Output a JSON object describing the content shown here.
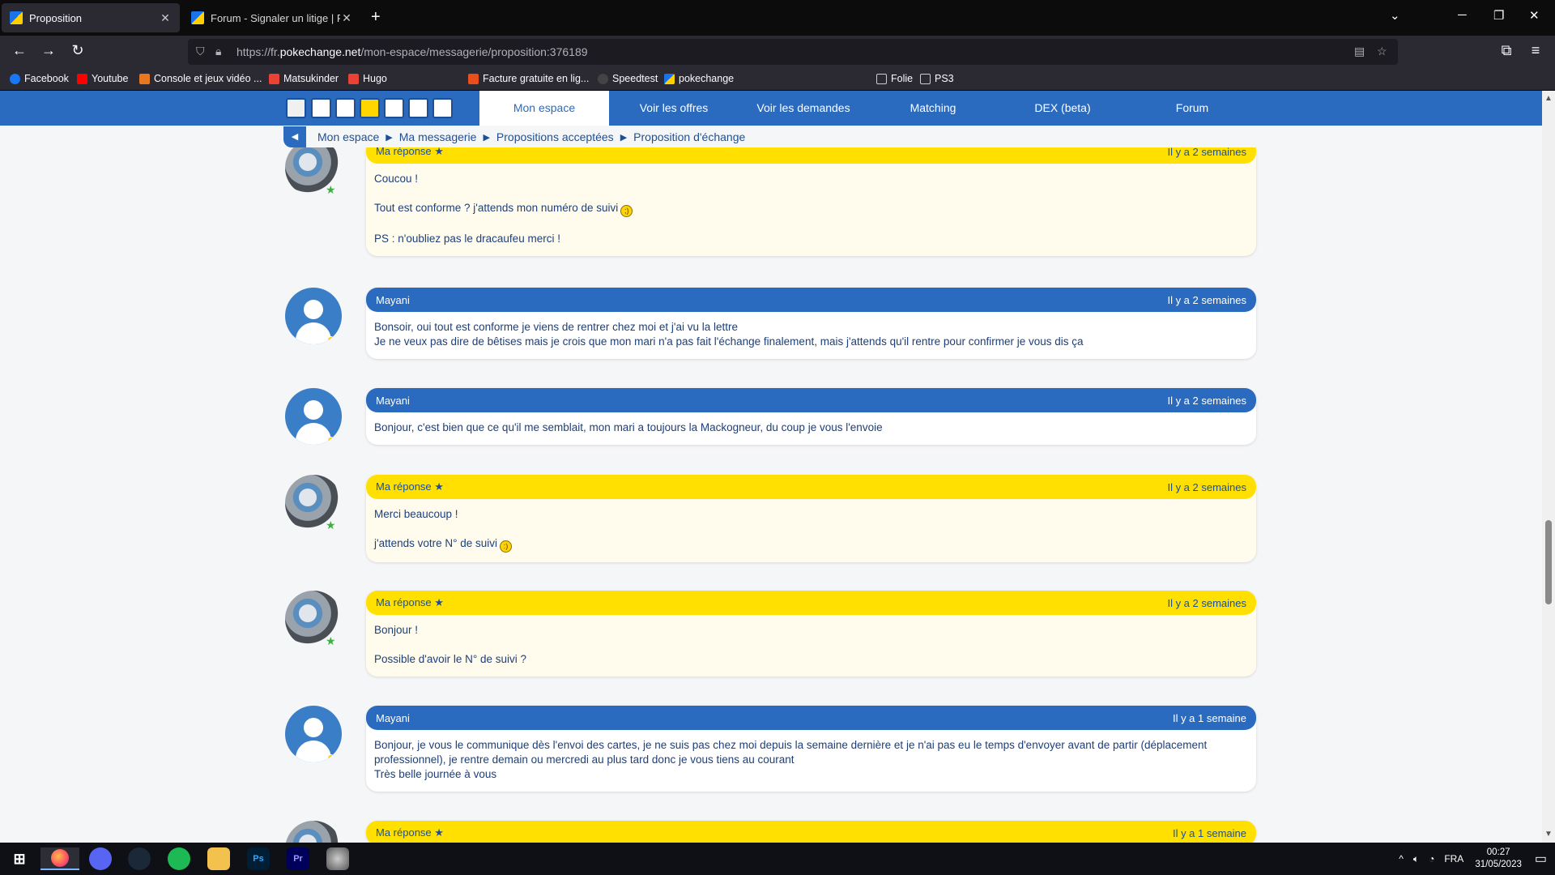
{
  "browser": {
    "tabs": [
      {
        "title": "Proposition",
        "active": true
      },
      {
        "title": "Forum - Signaler un litige | Pok",
        "active": false
      }
    ],
    "url_prefix": "https://fr.",
    "url_domain": "pokechange.net",
    "url_path": "/mon-espace/messagerie/proposition:376189",
    "bookmarks": [
      {
        "label": "Facebook",
        "color": "#1877f2"
      },
      {
        "label": "Youtube",
        "color": "#ff0000"
      },
      {
        "label": "Console et jeux vidéo ...",
        "color": "#e87722"
      },
      {
        "label": "Matsukinder",
        "color": "#ea4335"
      },
      {
        "label": "Hugo",
        "color": "#ea4335"
      },
      {
        "label": "Facture gratuite en lig...",
        "color": "#e94e1b"
      },
      {
        "label": "Speedtest",
        "color": "#444444"
      },
      {
        "label": "pokechange",
        "color": "#ffd000"
      },
      {
        "label": "Folie",
        "color": "#cccccc"
      },
      {
        "label": "PS3",
        "color": "#cccccc"
      }
    ]
  },
  "site": {
    "nav_tabs": [
      "Mon espace",
      "Voir les offres",
      "Voir les demandes",
      "Matching",
      "DEX (beta)",
      "Forum"
    ],
    "breadcrumb": [
      "Mon espace",
      "Ma messagerie",
      "Propositions acceptées",
      "Proposition d'échange"
    ]
  },
  "messages": [
    {
      "author": "Ma réponse ★",
      "time": "Il y a 2 semaines",
      "mine": true,
      "lines": [
        "Coucou !",
        "Tout est conforme ? j'attends mon numéro de suivi",
        "PS : n'oubliez pas le dracaufeu merci !"
      ]
    },
    {
      "author": "Mayani",
      "time": "Il y a 2 semaines",
      "mine": false,
      "lines": [
        "Bonsoir, oui tout est conforme je viens de rentrer chez moi et j'ai vu la lettre",
        "Je ne veux pas dire de bêtises mais je crois que mon mari n'a pas fait l'échange finalement, mais j'attends qu'il rentre pour confirmer je vous dis ça"
      ]
    },
    {
      "author": "Mayani",
      "time": "Il y a 2 semaines",
      "mine": false,
      "lines": [
        "Bonjour, c'est bien que ce qu'il me semblait, mon mari a toujours la Mackogneur, du coup je vous l'envoie"
      ]
    },
    {
      "author": "Ma réponse ★",
      "time": "Il y a 2 semaines",
      "mine": true,
      "lines": [
        "Merci beaucoup !",
        "j'attends votre N° de suivi"
      ]
    },
    {
      "author": "Ma réponse ★",
      "time": "Il y a 2 semaines",
      "mine": true,
      "lines": [
        "Bonjour !",
        "Possible d'avoir le N° de suivi ?"
      ]
    },
    {
      "author": "Mayani",
      "time": "Il y a 1 semaine",
      "mine": false,
      "lines": [
        "Bonjour, je vous le communique dès l'envoi des cartes, je ne suis pas chez moi depuis la semaine dernière et je n'ai pas eu le temps d'envoyer avant de partir (déplacement professionnel), je rentre demain ou mercredi au plus tard donc je vous tiens au courant",
        "Très belle journée à vous"
      ]
    },
    {
      "author": "Ma réponse ★",
      "time": "Il y a 1 semaine",
      "mine": true,
      "lines": []
    }
  ],
  "taskbar": {
    "apps": [
      "windows-start",
      "firefox",
      "discord",
      "steam",
      "spotify",
      "file-explorer",
      "photoshop",
      "premiere",
      "app"
    ],
    "app_labels": {
      "photoshop": "Ps",
      "premiere": "Pr"
    },
    "language": "FRA",
    "time": "00:27",
    "date": "31/05/2023"
  },
  "colors": {
    "brand_blue": "#2a6bbf",
    "brand_yellow": "#ffe000"
  }
}
